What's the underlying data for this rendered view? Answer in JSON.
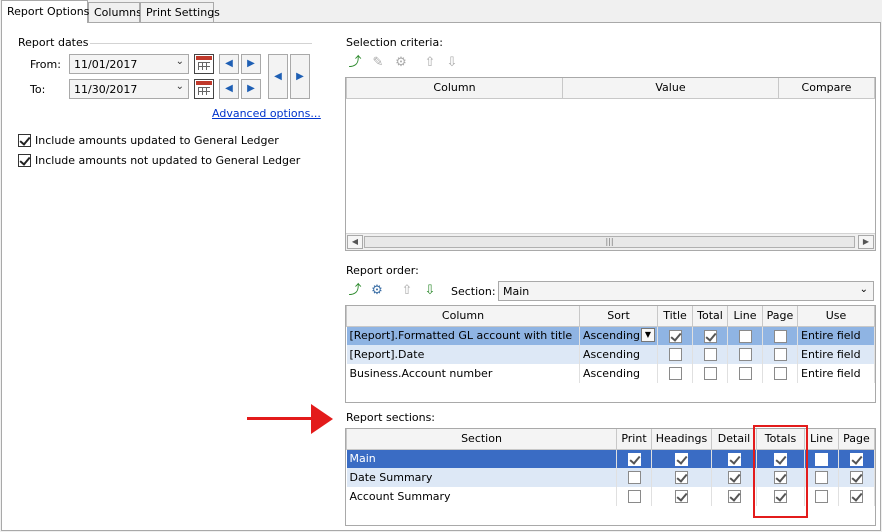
{
  "tabs": [
    "Report Options",
    "Columns",
    "Print Settings"
  ],
  "report_dates": {
    "title": "Report dates",
    "from_label": "From:",
    "from_value": "11/01/2017",
    "to_label": "To:",
    "to_value": "11/30/2017",
    "advanced_link": "Advanced options..."
  },
  "checkboxes": [
    {
      "label": "Include amounts updated to General Ledger",
      "checked": true
    },
    {
      "label": "Include amounts not updated to General Ledger",
      "checked": true
    }
  ],
  "selection_criteria": {
    "title": "Selection criteria:",
    "columns": [
      "Column",
      "Value",
      "Compare"
    ]
  },
  "report_order": {
    "title": "Report order:",
    "section_label": "Section:",
    "section_value": "Main",
    "columns": [
      "Column",
      "Sort",
      "Title",
      "Total",
      "Line",
      "Page",
      "Use"
    ],
    "rows": [
      {
        "column": "[Report].Formatted GL account with title",
        "sort": "Ascending",
        "title": true,
        "total": true,
        "line": false,
        "page": false,
        "use": "Entire field"
      },
      {
        "column": "[Report].Date",
        "sort": "Ascending",
        "title": false,
        "total": false,
        "line": false,
        "page": false,
        "use": "Entire field"
      },
      {
        "column": "Business.Account number",
        "sort": "Ascending",
        "title": false,
        "total": false,
        "line": false,
        "page": false,
        "use": "Entire field"
      }
    ]
  },
  "report_sections": {
    "title": "Report sections:",
    "columns": [
      "Section",
      "Print",
      "Headings",
      "Detail",
      "Totals",
      "Line",
      "Page"
    ],
    "rows": [
      {
        "section": "Main",
        "print": true,
        "headings": true,
        "detail": true,
        "totals": true,
        "line": false,
        "page": true
      },
      {
        "section": "Date Summary",
        "print": false,
        "headings": true,
        "detail": true,
        "totals": true,
        "line": false,
        "page": true
      },
      {
        "section": "Account Summary",
        "print": false,
        "headings": true,
        "detail": true,
        "totals": true,
        "line": false,
        "page": true
      }
    ]
  },
  "colors": {
    "annotation": "#e31b1b",
    "selected_row": "#3a6cc4",
    "highlight_row": "#8fb4e3"
  }
}
